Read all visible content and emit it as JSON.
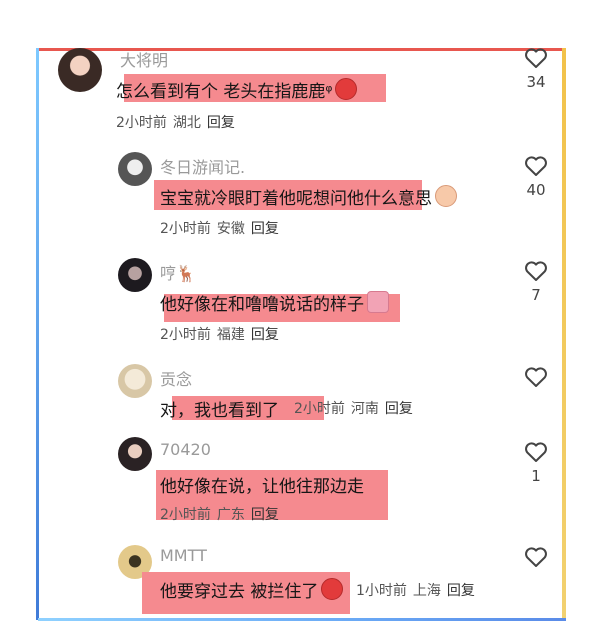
{
  "comments": [
    {
      "username": "大将明",
      "text": "怎么看到有个 老头在指鹿鹿ᵠ",
      "emoji": "angry",
      "time": "2小时前",
      "location": "湖北",
      "reply": "回复",
      "likes": "34"
    },
    {
      "username": "冬日游闻记.",
      "text": "宝宝就冷眼盯着他呢想问他什么意思",
      "emoji": "baby",
      "time": "2小时前",
      "location": "安徽",
      "reply": "回复",
      "likes": "40"
    },
    {
      "username": "哼🦌",
      "text": "他好像在和噜噜说话的样子",
      "emoji": "bag",
      "time": "2小时前",
      "location": "福建",
      "reply": "回复",
      "likes": "7"
    },
    {
      "username": "贡念",
      "text": "对，我也看到了",
      "time": "2小时前",
      "location": "河南",
      "reply": "回复",
      "likes": ""
    },
    {
      "username": "70420",
      "text": "他好像在说，让他往那边走",
      "time": "2小时前",
      "location": "广东",
      "reply": "回复",
      "likes": "1"
    },
    {
      "username": "MMTT",
      "text": "他要穿过去 被拦住了",
      "emoji": "angry",
      "time": "1小时前",
      "location": "上海",
      "reply": "回复",
      "likes": ""
    }
  ],
  "colors": {
    "highlight": "#f58a8f",
    "frame_top": "#e8574f",
    "frame_left": "#5b9ae8",
    "frame_right": "#f2c24a"
  }
}
